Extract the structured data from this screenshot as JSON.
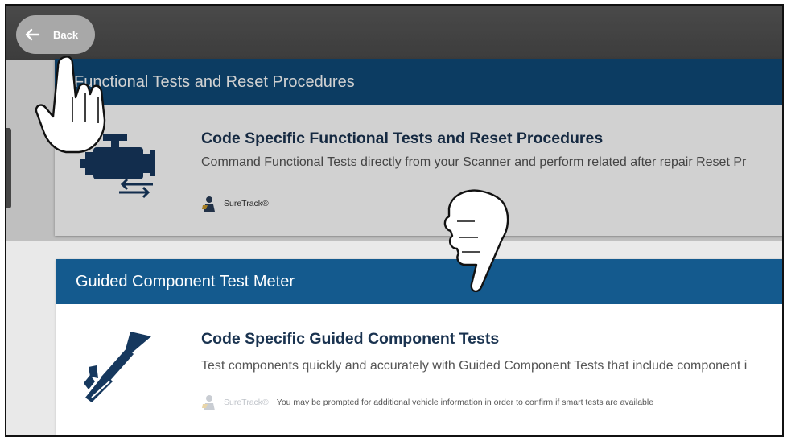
{
  "nav": {
    "back_label": "Back"
  },
  "sections": [
    {
      "header": "Functional Tests and Reset Procedures",
      "title": "Code Specific Functional Tests and Reset Procedures",
      "description": "Command Functional Tests directly from your Scanner and perform related after repair Reset Pr",
      "brand": "SureTrack®",
      "note": "",
      "icon": "engine-icon"
    },
    {
      "header": "Guided Component Test Meter",
      "title": "Code Specific Guided Component Tests",
      "description": "Test components quickly and accurately with Guided Component Tests that include component i",
      "brand": "SureTrack®",
      "note": "You may be prompted for additional vehicle information in order to confirm if smart tests are available",
      "icon": "test-probe-icon"
    }
  ],
  "colors": {
    "header_blue": "#145a8e",
    "title_navy": "#1a3350",
    "icon_navy": "#16385e"
  }
}
